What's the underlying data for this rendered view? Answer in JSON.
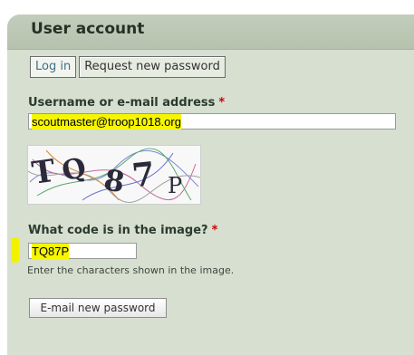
{
  "page_top_text": "",
  "block": {
    "title": "User account"
  },
  "tabs": [
    {
      "label": "Log in"
    },
    {
      "label": "Request new password"
    }
  ],
  "form": {
    "username_label": "Username or e-mail address",
    "required_marker": "*",
    "username_value": "scoutmaster@troop1018.org",
    "captcha_question_label": "What code is in the image?",
    "captcha_value": "TQ87P",
    "captcha_description": "Enter the characters shown in the image.",
    "submit_label": "E-mail new password"
  },
  "captcha_image": {
    "text": "TQ87P"
  },
  "colors": {
    "panel_bg": "#d6dfd0",
    "header_bg": "#b6c1ae",
    "required": "#d00000",
    "highlight": "#f6f600",
    "link": "#3f6e86"
  }
}
